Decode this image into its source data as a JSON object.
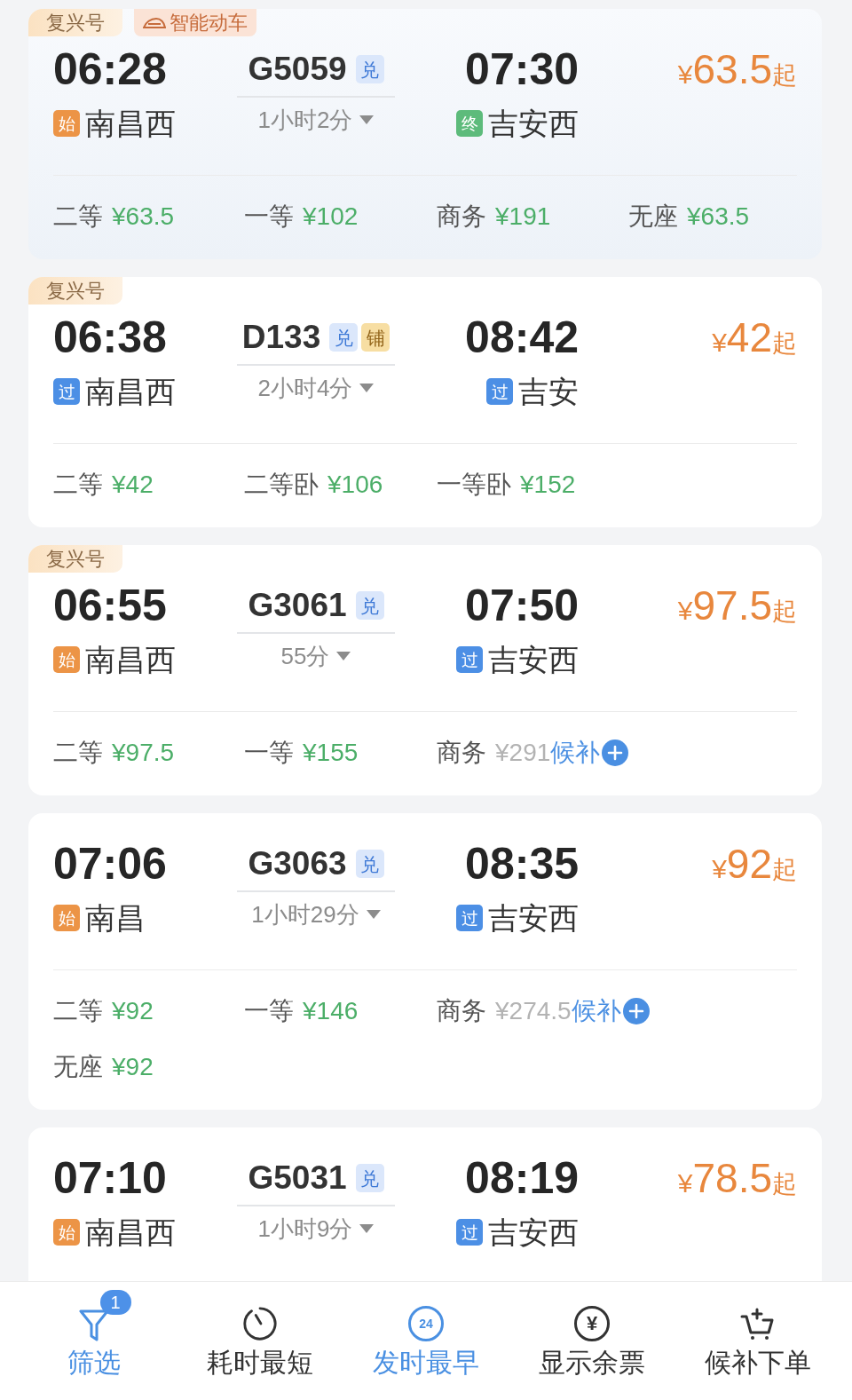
{
  "trains": [
    {
      "tags": [
        {
          "kind": "fuxing",
          "text": "复兴号"
        },
        {
          "kind": "smart",
          "text": "智能动车"
        }
      ],
      "highlighted": true,
      "depart": {
        "time": "06:28",
        "badge": {
          "kind": "start",
          "text": "始"
        },
        "station": "南昌西"
      },
      "train_no": "G5059",
      "train_badges": [
        {
          "kind": "exchange",
          "text": "兑"
        }
      ],
      "duration": "1小时2分",
      "arrive": {
        "time": "07:30",
        "badge": {
          "kind": "end",
          "text": "终"
        },
        "station": "吉安西"
      },
      "price": {
        "currency": "¥",
        "amount": "63.5",
        "suffix": "起"
      },
      "seats": [
        {
          "class": "二等",
          "price": "¥63.5",
          "available": true
        },
        {
          "class": "一等",
          "price": "¥102",
          "available": true
        },
        {
          "class": "商务",
          "price": "¥191",
          "available": true
        },
        {
          "class": "无座",
          "price": "¥63.5",
          "available": true
        }
      ]
    },
    {
      "tags": [
        {
          "kind": "fuxing",
          "text": "复兴号"
        }
      ],
      "highlighted": false,
      "depart": {
        "time": "06:38",
        "badge": {
          "kind": "pass",
          "text": "过"
        },
        "station": "南昌西"
      },
      "train_no": "D133",
      "train_badges": [
        {
          "kind": "exchange",
          "text": "兑"
        },
        {
          "kind": "sleeper",
          "text": "铺"
        }
      ],
      "duration": "2小时4分",
      "arrive": {
        "time": "08:42",
        "badge": {
          "kind": "pass",
          "text": "过"
        },
        "station": "吉安"
      },
      "price": {
        "currency": "¥",
        "amount": "42",
        "suffix": "起"
      },
      "seats": [
        {
          "class": "二等",
          "price": "¥42",
          "available": true
        },
        {
          "class": "二等卧",
          "price": "¥106",
          "available": true
        },
        {
          "class": "一等卧",
          "price": "¥152",
          "available": true
        }
      ]
    },
    {
      "tags": [
        {
          "kind": "fuxing",
          "text": "复兴号"
        }
      ],
      "highlighted": false,
      "depart": {
        "time": "06:55",
        "badge": {
          "kind": "start",
          "text": "始"
        },
        "station": "南昌西"
      },
      "train_no": "G3061",
      "train_badges": [
        {
          "kind": "exchange",
          "text": "兑"
        }
      ],
      "duration": "55分",
      "arrive": {
        "time": "07:50",
        "badge": {
          "kind": "pass",
          "text": "过"
        },
        "station": "吉安西"
      },
      "price": {
        "currency": "¥",
        "amount": "97.5",
        "suffix": "起"
      },
      "seats": [
        {
          "class": "二等",
          "price": "¥97.5",
          "available": true
        },
        {
          "class": "一等",
          "price": "¥155",
          "available": true
        },
        {
          "class": "商务",
          "price": "¥291",
          "available": false,
          "waitlist": "候补"
        }
      ]
    },
    {
      "highlighted": false,
      "depart": {
        "time": "07:06",
        "badge": {
          "kind": "start",
          "text": "始"
        },
        "station": "南昌"
      },
      "train_no": "G3063",
      "train_badges": [
        {
          "kind": "exchange",
          "text": "兑"
        }
      ],
      "duration": "1小时29分",
      "arrive": {
        "time": "08:35",
        "badge": {
          "kind": "pass",
          "text": "过"
        },
        "station": "吉安西"
      },
      "price": {
        "currency": "¥",
        "amount": "92",
        "suffix": "起"
      },
      "seats": [
        {
          "class": "二等",
          "price": "¥92",
          "available": true
        },
        {
          "class": "一等",
          "price": "¥146",
          "available": true
        },
        {
          "class": "商务",
          "price": "¥274.5",
          "available": false,
          "waitlist": "候补"
        },
        {
          "class": "无座",
          "price": "¥92",
          "available": true
        }
      ]
    },
    {
      "highlighted": false,
      "depart": {
        "time": "07:10",
        "badge": {
          "kind": "start",
          "text": "始"
        },
        "station": "南昌西"
      },
      "train_no": "G5031",
      "train_badges": [
        {
          "kind": "exchange",
          "text": "兑"
        }
      ],
      "duration": "1小时9分",
      "arrive": {
        "time": "08:19",
        "badge": {
          "kind": "pass",
          "text": "过"
        },
        "station": "吉安西"
      },
      "price": {
        "currency": "¥",
        "amount": "78.5",
        "suffix": "起"
      }
    }
  ],
  "bottom_bar": [
    {
      "kind": "filter",
      "label": "筛选",
      "active": true,
      "badge": "1"
    },
    {
      "kind": "duration",
      "label": "耗时最短",
      "active": false
    },
    {
      "kind": "earliest",
      "label": "发时最早",
      "active": true,
      "icon_text": "24"
    },
    {
      "kind": "remaining",
      "label": "显示余票",
      "active": false,
      "icon_text": "¥"
    },
    {
      "kind": "waitlist",
      "label": "候补下单",
      "active": false
    }
  ]
}
